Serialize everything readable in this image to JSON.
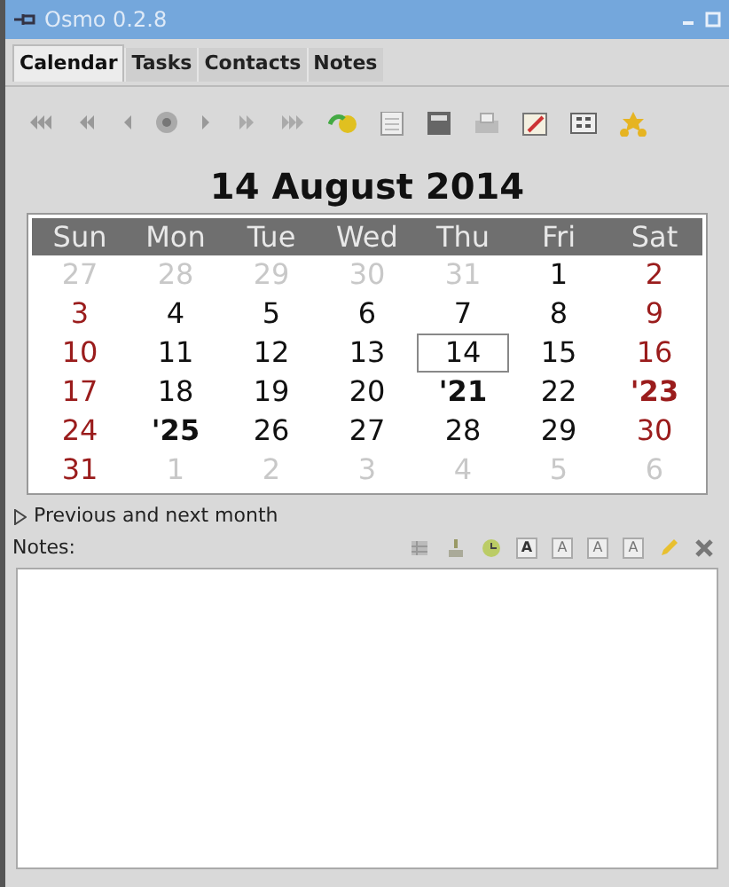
{
  "window": {
    "title": "Osmo 0.2.8"
  },
  "tabs": [
    {
      "label": "Calendar",
      "selected": true
    },
    {
      "label": "Tasks",
      "selected": false
    },
    {
      "label": "Contacts",
      "selected": false
    },
    {
      "label": "Notes",
      "selected": false
    }
  ],
  "date_heading": "14 August 2014",
  "calendar": {
    "weekdays": [
      "Sun",
      "Mon",
      "Tue",
      "Wed",
      "Thu",
      "Fri",
      "Sat"
    ],
    "weeks": [
      [
        {
          "text": "27",
          "kind": "other",
          "bold": false,
          "selected": false
        },
        {
          "text": "28",
          "kind": "other",
          "bold": false,
          "selected": false
        },
        {
          "text": "29",
          "kind": "other",
          "bold": false,
          "selected": false
        },
        {
          "text": "30",
          "kind": "other",
          "bold": false,
          "selected": false
        },
        {
          "text": "31",
          "kind": "other",
          "bold": false,
          "selected": false
        },
        {
          "text": "1",
          "kind": "normal",
          "bold": false,
          "selected": false
        },
        {
          "text": "2",
          "kind": "weekend",
          "bold": false,
          "selected": false
        }
      ],
      [
        {
          "text": "3",
          "kind": "weekend",
          "bold": false,
          "selected": false
        },
        {
          "text": "4",
          "kind": "normal",
          "bold": false,
          "selected": false
        },
        {
          "text": "5",
          "kind": "normal",
          "bold": false,
          "selected": false
        },
        {
          "text": "6",
          "kind": "normal",
          "bold": false,
          "selected": false
        },
        {
          "text": "7",
          "kind": "normal",
          "bold": false,
          "selected": false
        },
        {
          "text": "8",
          "kind": "normal",
          "bold": false,
          "selected": false
        },
        {
          "text": "9",
          "kind": "weekend",
          "bold": false,
          "selected": false
        }
      ],
      [
        {
          "text": "10",
          "kind": "weekend",
          "bold": false,
          "selected": false
        },
        {
          "text": "11",
          "kind": "normal",
          "bold": false,
          "selected": false
        },
        {
          "text": "12",
          "kind": "normal",
          "bold": false,
          "selected": false
        },
        {
          "text": "13",
          "kind": "normal",
          "bold": false,
          "selected": false
        },
        {
          "text": "14",
          "kind": "normal",
          "bold": false,
          "selected": true
        },
        {
          "text": "15",
          "kind": "normal",
          "bold": false,
          "selected": false
        },
        {
          "text": "16",
          "kind": "weekend",
          "bold": false,
          "selected": false
        }
      ],
      [
        {
          "text": "17",
          "kind": "weekend",
          "bold": false,
          "selected": false
        },
        {
          "text": "18",
          "kind": "normal",
          "bold": false,
          "selected": false
        },
        {
          "text": "19",
          "kind": "normal",
          "bold": false,
          "selected": false
        },
        {
          "text": "20",
          "kind": "normal",
          "bold": false,
          "selected": false
        },
        {
          "text": "'21",
          "kind": "normal",
          "bold": true,
          "selected": false
        },
        {
          "text": "22",
          "kind": "normal",
          "bold": false,
          "selected": false
        },
        {
          "text": "'23",
          "kind": "weekend",
          "bold": true,
          "selected": false
        }
      ],
      [
        {
          "text": "24",
          "kind": "weekend",
          "bold": false,
          "selected": false
        },
        {
          "text": "'25",
          "kind": "normal",
          "bold": true,
          "selected": false
        },
        {
          "text": "26",
          "kind": "normal",
          "bold": false,
          "selected": false
        },
        {
          "text": "27",
          "kind": "normal",
          "bold": false,
          "selected": false
        },
        {
          "text": "28",
          "kind": "normal",
          "bold": false,
          "selected": false
        },
        {
          "text": "29",
          "kind": "normal",
          "bold": false,
          "selected": false
        },
        {
          "text": "30",
          "kind": "weekend",
          "bold": false,
          "selected": false
        }
      ],
      [
        {
          "text": "31",
          "kind": "weekend",
          "bold": false,
          "selected": false
        },
        {
          "text": "1",
          "kind": "other",
          "bold": false,
          "selected": false
        },
        {
          "text": "2",
          "kind": "other",
          "bold": false,
          "selected": false
        },
        {
          "text": "3",
          "kind": "other",
          "bold": false,
          "selected": false
        },
        {
          "text": "4",
          "kind": "other",
          "bold": false,
          "selected": false
        },
        {
          "text": "5",
          "kind": "other",
          "bold": false,
          "selected": false
        },
        {
          "text": "6",
          "kind": "other",
          "bold": false,
          "selected": false
        }
      ]
    ]
  },
  "expander": {
    "label": "Previous and next month",
    "expanded": false
  },
  "notes": {
    "label": "Notes:",
    "format_buttons": [
      "A",
      "A",
      "A",
      "A"
    ]
  }
}
